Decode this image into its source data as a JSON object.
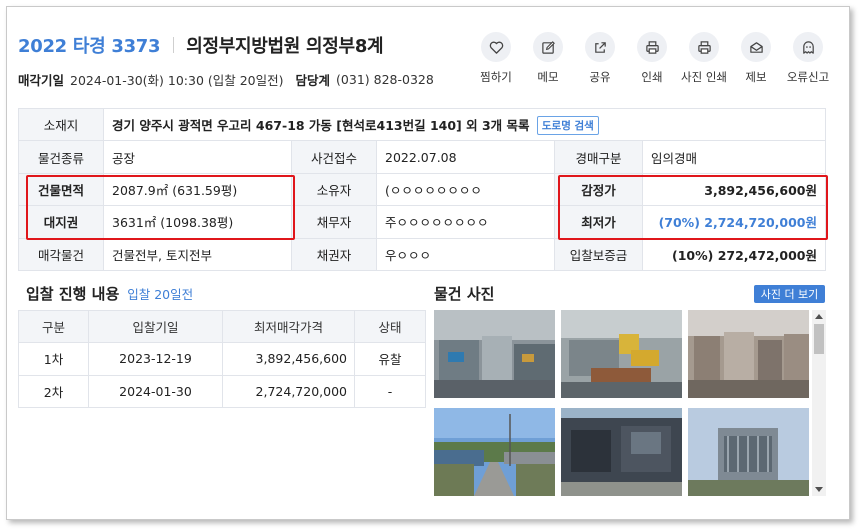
{
  "header": {
    "case_number": "2022 타경 3373",
    "court": "의정부지방법원 의정부8계",
    "auction_date_label": "매각기일",
    "auction_date_value": "2024-01-30(화) 10:30 (입찰 20일전)",
    "manager_label": "담당계",
    "manager_phone": "(031) 828-0328"
  },
  "actions": [
    {
      "label": "찜하기",
      "icon": "heart-icon"
    },
    {
      "label": "메모",
      "icon": "memo-icon"
    },
    {
      "label": "공유",
      "icon": "share-icon"
    },
    {
      "label": "인쇄",
      "icon": "print-icon"
    },
    {
      "label": "사진 인쇄",
      "icon": "photo-print-icon"
    },
    {
      "label": "제보",
      "icon": "mail-icon"
    },
    {
      "label": "오류신고",
      "icon": "ghost-icon"
    }
  ],
  "info": {
    "location_label": "소재지",
    "location_value": "경기 양주시 광적면 우고리 467-18 가동 [현석로413번길 140] 외 3개 목록",
    "road_search_button": "도로명 검색",
    "type_label": "물건종류",
    "type_value": "공장",
    "received_label": "사건접수",
    "received_value": "2022.07.08",
    "auction_type_label": "경매구분",
    "auction_type_value": "임의경매",
    "building_area_label": "건물면적",
    "building_area_value": "2087.9㎡ (631.59평)",
    "owner_label": "소유자",
    "owner_value": "(ㅇㅇㅇㅇㅇㅇㅇㅇ",
    "appraisal_label": "감정가",
    "appraisal_value": "3,892,456,600원",
    "land_right_label": "대지권",
    "land_right_value": "3631㎡ (1098.38평)",
    "debtor_label": "채무자",
    "debtor_value": "주ㅇㅇㅇㅇㅇㅇㅇㅇ",
    "minimum_label": "최저가",
    "minimum_value": "(70%) 2,724,720,000원",
    "sale_object_label": "매각물건",
    "sale_object_value": "건물전부, 토지전부",
    "creditor_label": "채권자",
    "creditor_value": "우ㅇㅇㅇ",
    "deposit_label": "입찰보증금",
    "deposit_value": "(10%) 272,472,000원"
  },
  "bid_history": {
    "title": "입찰 진행 내용",
    "subtitle": "입찰 20일전",
    "headers": [
      "구분",
      "입찰기일",
      "최저매각가격",
      "상태"
    ],
    "rows": [
      {
        "round": "1차",
        "date": "2023-12-19",
        "price": "3,892,456,600",
        "status": "유찰"
      },
      {
        "round": "2차",
        "date": "2024-01-30",
        "price": "2,724,720,000",
        "status": "-"
      }
    ]
  },
  "photos": {
    "title": "물건 사진",
    "more_button": "사진 더 보기"
  },
  "colors": {
    "accent": "#3f7fd6",
    "highlight_border": "#e0161b",
    "header_cell_bg": "#f3f5f8"
  }
}
